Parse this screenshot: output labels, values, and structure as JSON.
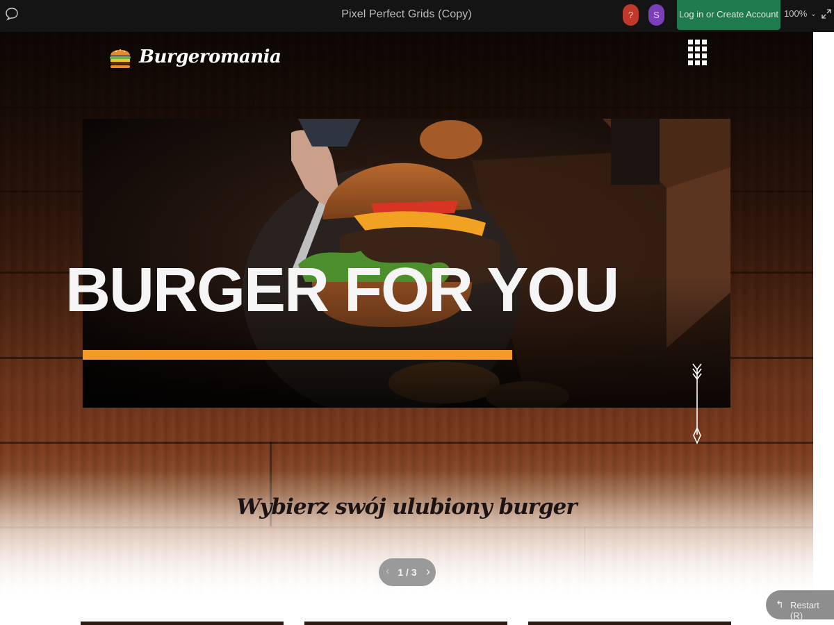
{
  "viewer": {
    "title": "Pixel Perfect Grids (Copy)",
    "help_label": "?",
    "user_initial": "S",
    "login_label": "Log in or Create Account",
    "zoom": "100%",
    "zoom_chevron": "⌄",
    "colors": {
      "help": "#c0392b",
      "user": "#7b3fb8",
      "login": "#1f7a4d"
    }
  },
  "site": {
    "brand": "Burgeromania",
    "hero_title": "BURGER FOR YOU",
    "section_title": "Wybierz swój ulubiony burger",
    "accent_color": "#f39a27"
  },
  "pager": {
    "prev_icon": "‹",
    "count": "1 / 3",
    "next_icon": "›"
  },
  "restart": {
    "icon": "↰",
    "label": "Restart (R)"
  },
  "icons": [
    "chat-bubble-icon",
    "expand-icon",
    "burger-logo-icon",
    "grid-menu-icon",
    "scroll-down-arrow-icon"
  ]
}
